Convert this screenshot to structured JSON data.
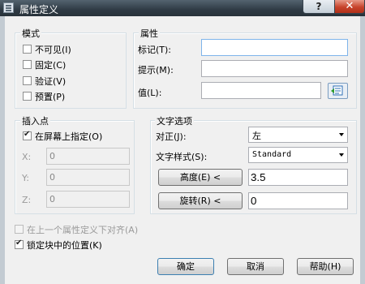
{
  "window": {
    "title": "属性定义",
    "help_glyph": "?",
    "close_glyph": "✕"
  },
  "mode": {
    "label": "模式",
    "items": [
      {
        "label": "不可见(I)",
        "checked": false
      },
      {
        "label": "固定(C)",
        "checked": false
      },
      {
        "label": "验证(V)",
        "checked": false
      },
      {
        "label": "预置(P)",
        "checked": false
      }
    ]
  },
  "attribute": {
    "label": "属性",
    "tag_label": "标记(T):",
    "tag_value": "",
    "prompt_label": "提示(M):",
    "prompt_value": "",
    "default_label": "值(L):",
    "default_value": "",
    "field_icon": "insert-field-icon"
  },
  "insertion": {
    "label": "插入点",
    "on_screen_label": "在屏幕上指定(O)",
    "on_screen_checked": true,
    "x_label": "X:",
    "x_value": "0",
    "y_label": "Y:",
    "y_value": "0",
    "z_label": "Z:",
    "z_value": "0"
  },
  "text": {
    "label": "文字选项",
    "justify_label": "对正(J):",
    "justify_value": "左",
    "style_label": "文字样式(S):",
    "style_value": "Standard",
    "height_button": "高度(E) <",
    "height_value": "3.5",
    "rotation_button": "旋转(R) <",
    "rotation_value": "0"
  },
  "align_below": {
    "label": "在上一个属性定义下对齐(A)",
    "checked": false,
    "disabled": true
  },
  "lock_position": {
    "label": "锁定块中的位置(K)",
    "checked": true
  },
  "buttons": {
    "ok": "确定",
    "cancel": "取消",
    "help": "帮助(H)"
  },
  "colors": {
    "titlebar": "#2f3b45",
    "close": "#c7432b",
    "focus_border": "#7eb4ea"
  }
}
